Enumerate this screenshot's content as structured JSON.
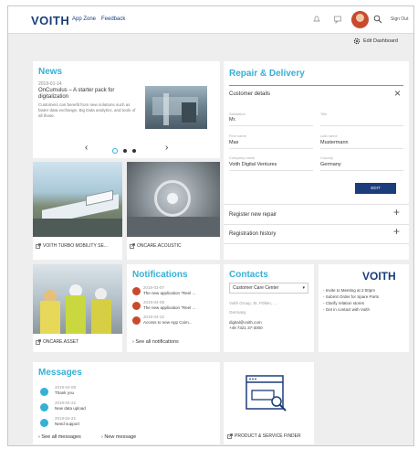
{
  "header": {
    "logo": "VOITH",
    "nav": [
      "App Zone",
      "Feedback"
    ],
    "signout": "Sign Out"
  },
  "toolbar": {
    "edit_dashboard": "Edit Dashboard"
  },
  "news": {
    "title": "News",
    "date": "2019-01-14",
    "headline": "OnCumulus – A starter pack for digitalization",
    "body": "Customers can benefit from new solutions such as faster data exchange, Big Data analytics, and tools of all those."
  },
  "tiles": {
    "tile1": "VOITH TURBO MOBILITY SE...",
    "tile2": "ONCARE.ACOUSTIC",
    "tile3": "ONCARE.ASSET"
  },
  "repair": {
    "title": "Repair & Delivery",
    "section": "Customer details",
    "fields": [
      {
        "label": "Salutation",
        "value": "Mr."
      },
      {
        "label": "Title",
        "value": ""
      },
      {
        "label": "First name",
        "value": "Max"
      },
      {
        "label": "Last name",
        "value": "Mustermann"
      },
      {
        "label": "Company name",
        "value": "Voith Digital Ventures"
      },
      {
        "label": "Country",
        "value": "Germany"
      }
    ],
    "edit_label": "EDIT",
    "rows": [
      "Register new repair",
      "Registration history"
    ]
  },
  "notifications": {
    "title": "Notifications",
    "items": [
      {
        "date": "2019-03-07",
        "text": "The new application \"Reel ..."
      },
      {
        "date": "2019-04-08",
        "text": "The new application \"Reel ..."
      },
      {
        "date": "2019-04-22",
        "text": "Access to new App Coim..."
      }
    ],
    "see_all": "See all notifications"
  },
  "contacts": {
    "title": "Contacts",
    "selected": "Customer Care Center",
    "address1": "Voith Group, St. Pölten, ...",
    "address2": "Germany",
    "email": "digital@voith.com",
    "phone": "+49 7321 37-3000"
  },
  "promo": {
    "logo": "VOITH",
    "bullets": [
      "- Invite to Meeting at 2:00pm",
      "- Submit Order for Spare Parts",
      "- Clarify relation stores",
      "- Get in contact with Voith"
    ]
  },
  "messages": {
    "title": "Messages",
    "items": [
      {
        "date": "2019-04-08",
        "text": "Thank you"
      },
      {
        "date": "2019-04-22",
        "text": "New data upload"
      },
      {
        "date": "2019-04-22",
        "text": "Need support"
      }
    ],
    "see_all": "See all messages",
    "new_message": "New message"
  },
  "finder": {
    "caption": "PRODUCT & SERVICE FINDER"
  },
  "colors": {
    "accent": "#36b0d6",
    "brand": "#1b3d7a",
    "avatar": "#c84a2e"
  }
}
